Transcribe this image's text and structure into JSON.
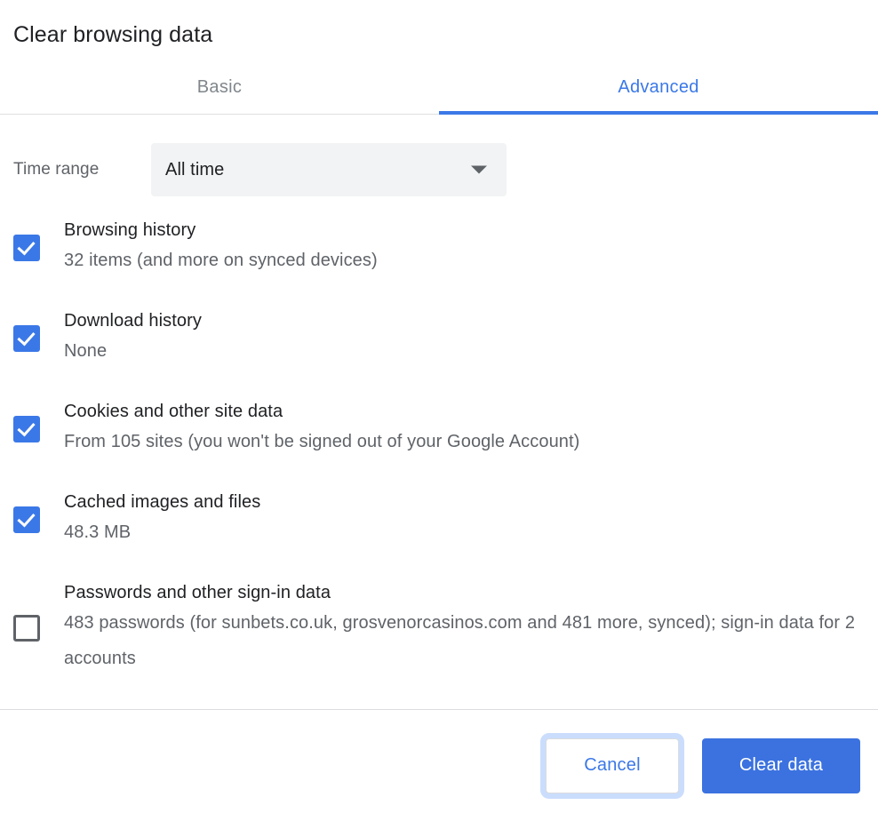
{
  "dialog": {
    "title": "Clear browsing data"
  },
  "tabs": [
    {
      "id": "basic",
      "label": "Basic",
      "active": false
    },
    {
      "id": "advanced",
      "label": "Advanced",
      "active": true
    }
  ],
  "time_range": {
    "label": "Time range",
    "selected": "All time",
    "arrow_icon": "chevron-down-icon"
  },
  "items": [
    {
      "id": "browsing-history",
      "label": "Browsing history",
      "sublabel": "32 items (and more on synced devices)",
      "checked": true
    },
    {
      "id": "download-history",
      "label": "Download history",
      "sublabel": "None",
      "checked": true
    },
    {
      "id": "cookies-and-site-data",
      "label": "Cookies and other site data",
      "sublabel": "From 105 sites (you won't be signed out of your Google Account)",
      "checked": true
    },
    {
      "id": "cached-images-and-files",
      "label": "Cached images and files",
      "sublabel": "48.3 MB",
      "checked": true
    },
    {
      "id": "passwords-and-signin-data",
      "label": "Passwords and other sign-in data",
      "sublabel": "483 passwords (for sunbets.co.uk, grosvenorcasinos.com and 481 more, synced); sign-in data for 2 accounts",
      "checked": false
    }
  ],
  "footer": {
    "cancel_label": "Cancel",
    "confirm_label": "Clear data"
  },
  "colors": {
    "accent_blue": "#3b78e7",
    "primary_button_blue": "#3b72e0",
    "text_primary": "#202124",
    "text_secondary": "#5f6368",
    "tab_inactive": "#80868b",
    "select_background": "#f1f3f4",
    "divider": "#dadce0"
  }
}
